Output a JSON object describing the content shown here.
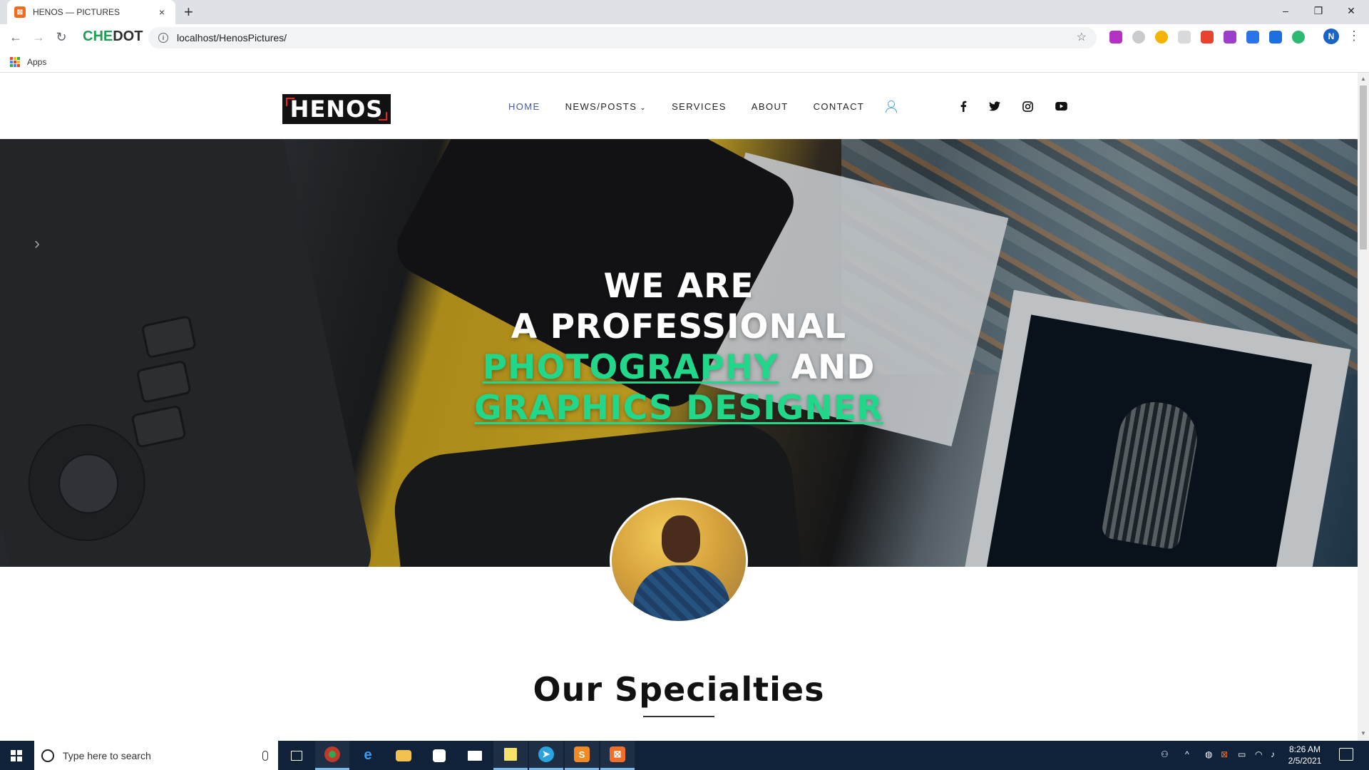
{
  "browser": {
    "tab_title": "HENOS — PICTURES",
    "tab_favicon_icon": "xampp-icon",
    "close_glyph": "×",
    "new_tab_glyph": "+",
    "brand_prefix": "CHE",
    "brand_suffix": "DOT",
    "url": "localhost/HenosPictures/",
    "profile_initial": "N",
    "bookmarks_apps_label": "Apps",
    "window_controls": [
      "–",
      "❐",
      "✕"
    ]
  },
  "site": {
    "logo_text": "HENOS",
    "nav": [
      {
        "label": "HOME",
        "active": true
      },
      {
        "label": "NEWS/POSTS",
        "dropdown": true
      },
      {
        "label": "SERVICES"
      },
      {
        "label": "ABOUT"
      },
      {
        "label": "CONTACT"
      }
    ],
    "social_icons": [
      "facebook-icon",
      "twitter-icon",
      "instagram-icon",
      "youtube-icon"
    ],
    "accent_color": "#21d88a",
    "nav_active_color": "#4b5a9a"
  },
  "hero": {
    "line1": "WE ARE",
    "line2": "A PROFESSIONAL",
    "line3_highlight": "PHOTOGRAPHY",
    "line3_rest": " AND",
    "line4_highlight": "GRAPHICS DESIGNER",
    "slider_arrow": "›"
  },
  "section": {
    "title": "Our Specialties"
  },
  "taskbar": {
    "search_placeholder": "Type here to search",
    "apps": [
      "task-view-icon",
      "chedot-browser-icon",
      "edge-icon",
      "file-explorer-icon",
      "store-icon",
      "mail-icon",
      "sticky-notes-icon",
      "telegram-icon",
      "sublime-text-icon",
      "xampp-icon"
    ],
    "time": "8:26 AM",
    "date": "2/5/2021"
  }
}
